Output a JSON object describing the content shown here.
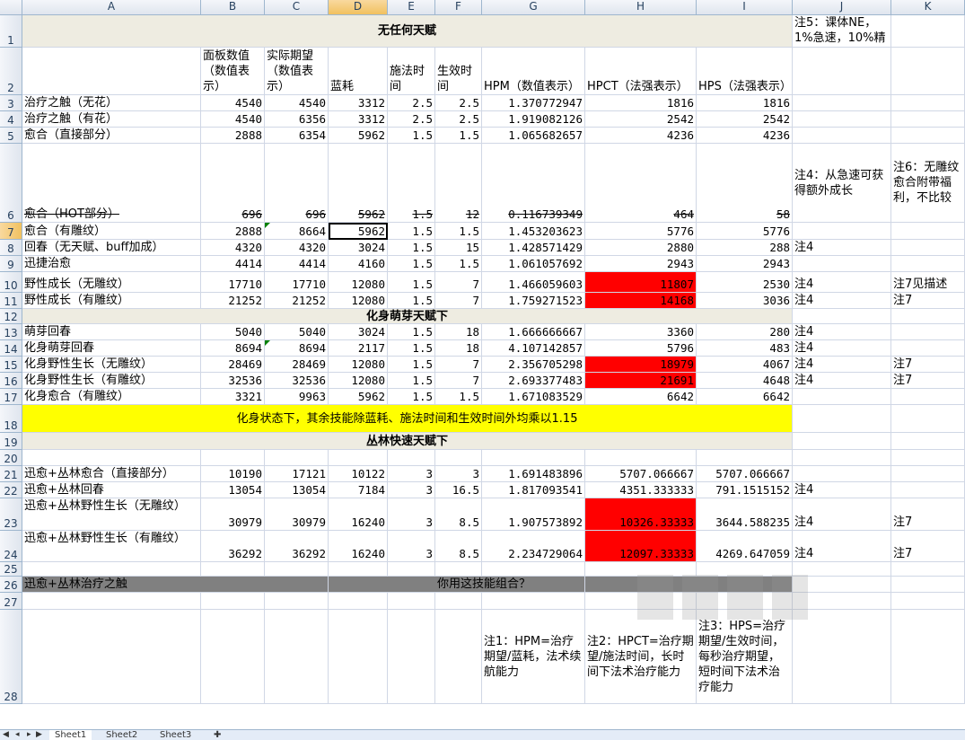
{
  "columns": [
    "A",
    "B",
    "C",
    "D",
    "E",
    "F",
    "G",
    "H",
    "I",
    "J",
    "K"
  ],
  "rows": [
    "1",
    "2",
    "3",
    "4",
    "5",
    "6",
    "7",
    "8",
    "9",
    "10",
    "11",
    "12",
    "13",
    "14",
    "15",
    "16",
    "17",
    "18",
    "19",
    "20",
    "21",
    "22",
    "23",
    "24",
    "25",
    "26",
    "27",
    "28"
  ],
  "selected_column": "D",
  "selected_row": "7",
  "cells": {
    "r1_title": "无任何天赋",
    "j1": "注5：课体NE，1%急速，10%精通",
    "b2": "面板数值（数值表示）",
    "c2": "实际期望（数值表示）",
    "d2": "蓝耗",
    "e2": "施法时间",
    "f2": "生效时间",
    "g2": "HPM（数值表示）",
    "h2": "HPCT（法强表示）",
    "i2": "HPS（法强表示）",
    "r3": [
      "治疗之触（无花）",
      "4540",
      "4540",
      "3312",
      "2.5",
      "2.5",
      "1.370772947",
      "1816",
      "1816"
    ],
    "r4": [
      "治疗之触（有花）",
      "4540",
      "6356",
      "3312",
      "2.5",
      "2.5",
      "1.919082126",
      "2542",
      "2542"
    ],
    "r5": [
      "愈合（直接部分）",
      "2888",
      "6354",
      "5962",
      "1.5",
      "1.5",
      "1.065682657",
      "4236",
      "4236"
    ],
    "r6": [
      "愈合（HOT部分）",
      "696",
      "696",
      "5962",
      "1.5",
      "12",
      "0.116739349",
      "464",
      "58"
    ],
    "j6": "注4：从急速可获得额外成长",
    "k6": "注6：无雕纹愈合附带福利，不比较",
    "r7": [
      "愈合（有雕纹）",
      "2888",
      "8664",
      "5962",
      "1.5",
      "1.5",
      "1.453203623",
      "5776",
      "5776"
    ],
    "r8": [
      "回春（无天赋、buff加成）",
      "4320",
      "4320",
      "3024",
      "1.5",
      "15",
      "1.428571429",
      "2880",
      "288"
    ],
    "j8": "注4",
    "r9": [
      "迅捷治愈",
      "4414",
      "4414",
      "4160",
      "1.5",
      "1.5",
      "1.061057692",
      "2943",
      "2943"
    ],
    "r10": [
      "野性成长（无雕纹）",
      "17710",
      "17710",
      "12080",
      "1.5",
      "7",
      "1.466059603",
      "11807",
      "2530"
    ],
    "j10": "注4",
    "k10": "注7见描述",
    "r11": [
      "野性成长（有雕纹）",
      "21252",
      "21252",
      "12080",
      "1.5",
      "7",
      "1.759271523",
      "14168",
      "3036"
    ],
    "j11": "注4",
    "k11": "注7",
    "r12_title": "化身萌芽天赋下",
    "r13": [
      "萌芽回春",
      "5040",
      "5040",
      "3024",
      "1.5",
      "18",
      "1.666666667",
      "3360",
      "280"
    ],
    "j13": "注4",
    "r14": [
      "化身萌芽回春",
      "8694",
      "8694",
      "2117",
      "1.5",
      "18",
      "4.107142857",
      "5796",
      "483"
    ],
    "j14": "注4",
    "r15": [
      "化身野性生长（无雕纹）",
      "28469",
      "28469",
      "12080",
      "1.5",
      "7",
      "2.356705298",
      "18979",
      "4067"
    ],
    "j15": "注4",
    "k15": "注7",
    "r16": [
      "化身野性生长（有雕纹）",
      "32536",
      "32536",
      "12080",
      "1.5",
      "7",
      "2.693377483",
      "21691",
      "4648"
    ],
    "j16": "注4",
    "k16": "注7",
    "r17": [
      "化身愈合（有雕纹）",
      "3321",
      "9963",
      "5962",
      "1.5",
      "1.5",
      "1.671083529",
      "6642",
      "6642"
    ],
    "r18_note": "化身状态下，其余技能除蓝耗、施法时间和生效时间外均乘以1.15",
    "r19_title": "丛林快速天赋下",
    "r21": [
      "迅愈+丛林愈合（直接部分）",
      "10190",
      "17121",
      "10122",
      "3",
      "3",
      "1.691483896",
      "5707.066667",
      "5707.066667"
    ],
    "r22": [
      "迅愈+丛林回春",
      "13054",
      "13054",
      "7184",
      "3",
      "16.5",
      "1.817093541",
      "4351.333333",
      "791.1515152"
    ],
    "j22": "注4",
    "r23": [
      "迅愈+丛林野性生长（无雕纹）",
      "30979",
      "30979",
      "16240",
      "3",
      "8.5",
      "1.907573892",
      "10326.33333",
      "3644.588235"
    ],
    "j23": "注4",
    "k23": "注7",
    "r24": [
      "迅愈+丛林野性生长（有雕纹）",
      "36292",
      "36292",
      "16240",
      "3",
      "8.5",
      "2.234729064",
      "12097.33333",
      "4269.647059"
    ],
    "j24": "注4",
    "k24": "注7",
    "a26": "迅愈+丛林治疗之触",
    "f26": "你用这技能组合？",
    "g28": "注1：HPM=治疗期望/蓝耗，法术续航能力",
    "h28": "注2：HPCT=治疗期望/施法时间，长时间下法术治疗能力",
    "i28": "注3：HPS=治疗期望/生效时间，每秒治疗期望，短时间下法术治疗能力"
  },
  "sheet_tabs": [
    "Sheet1",
    "Sheet2",
    "Sheet3"
  ],
  "colors": {
    "beige": "#eeece1",
    "yellow": "#ffff00",
    "red": "#ff0000",
    "gray": "#808080",
    "selected_header": "#f1c15f"
  }
}
